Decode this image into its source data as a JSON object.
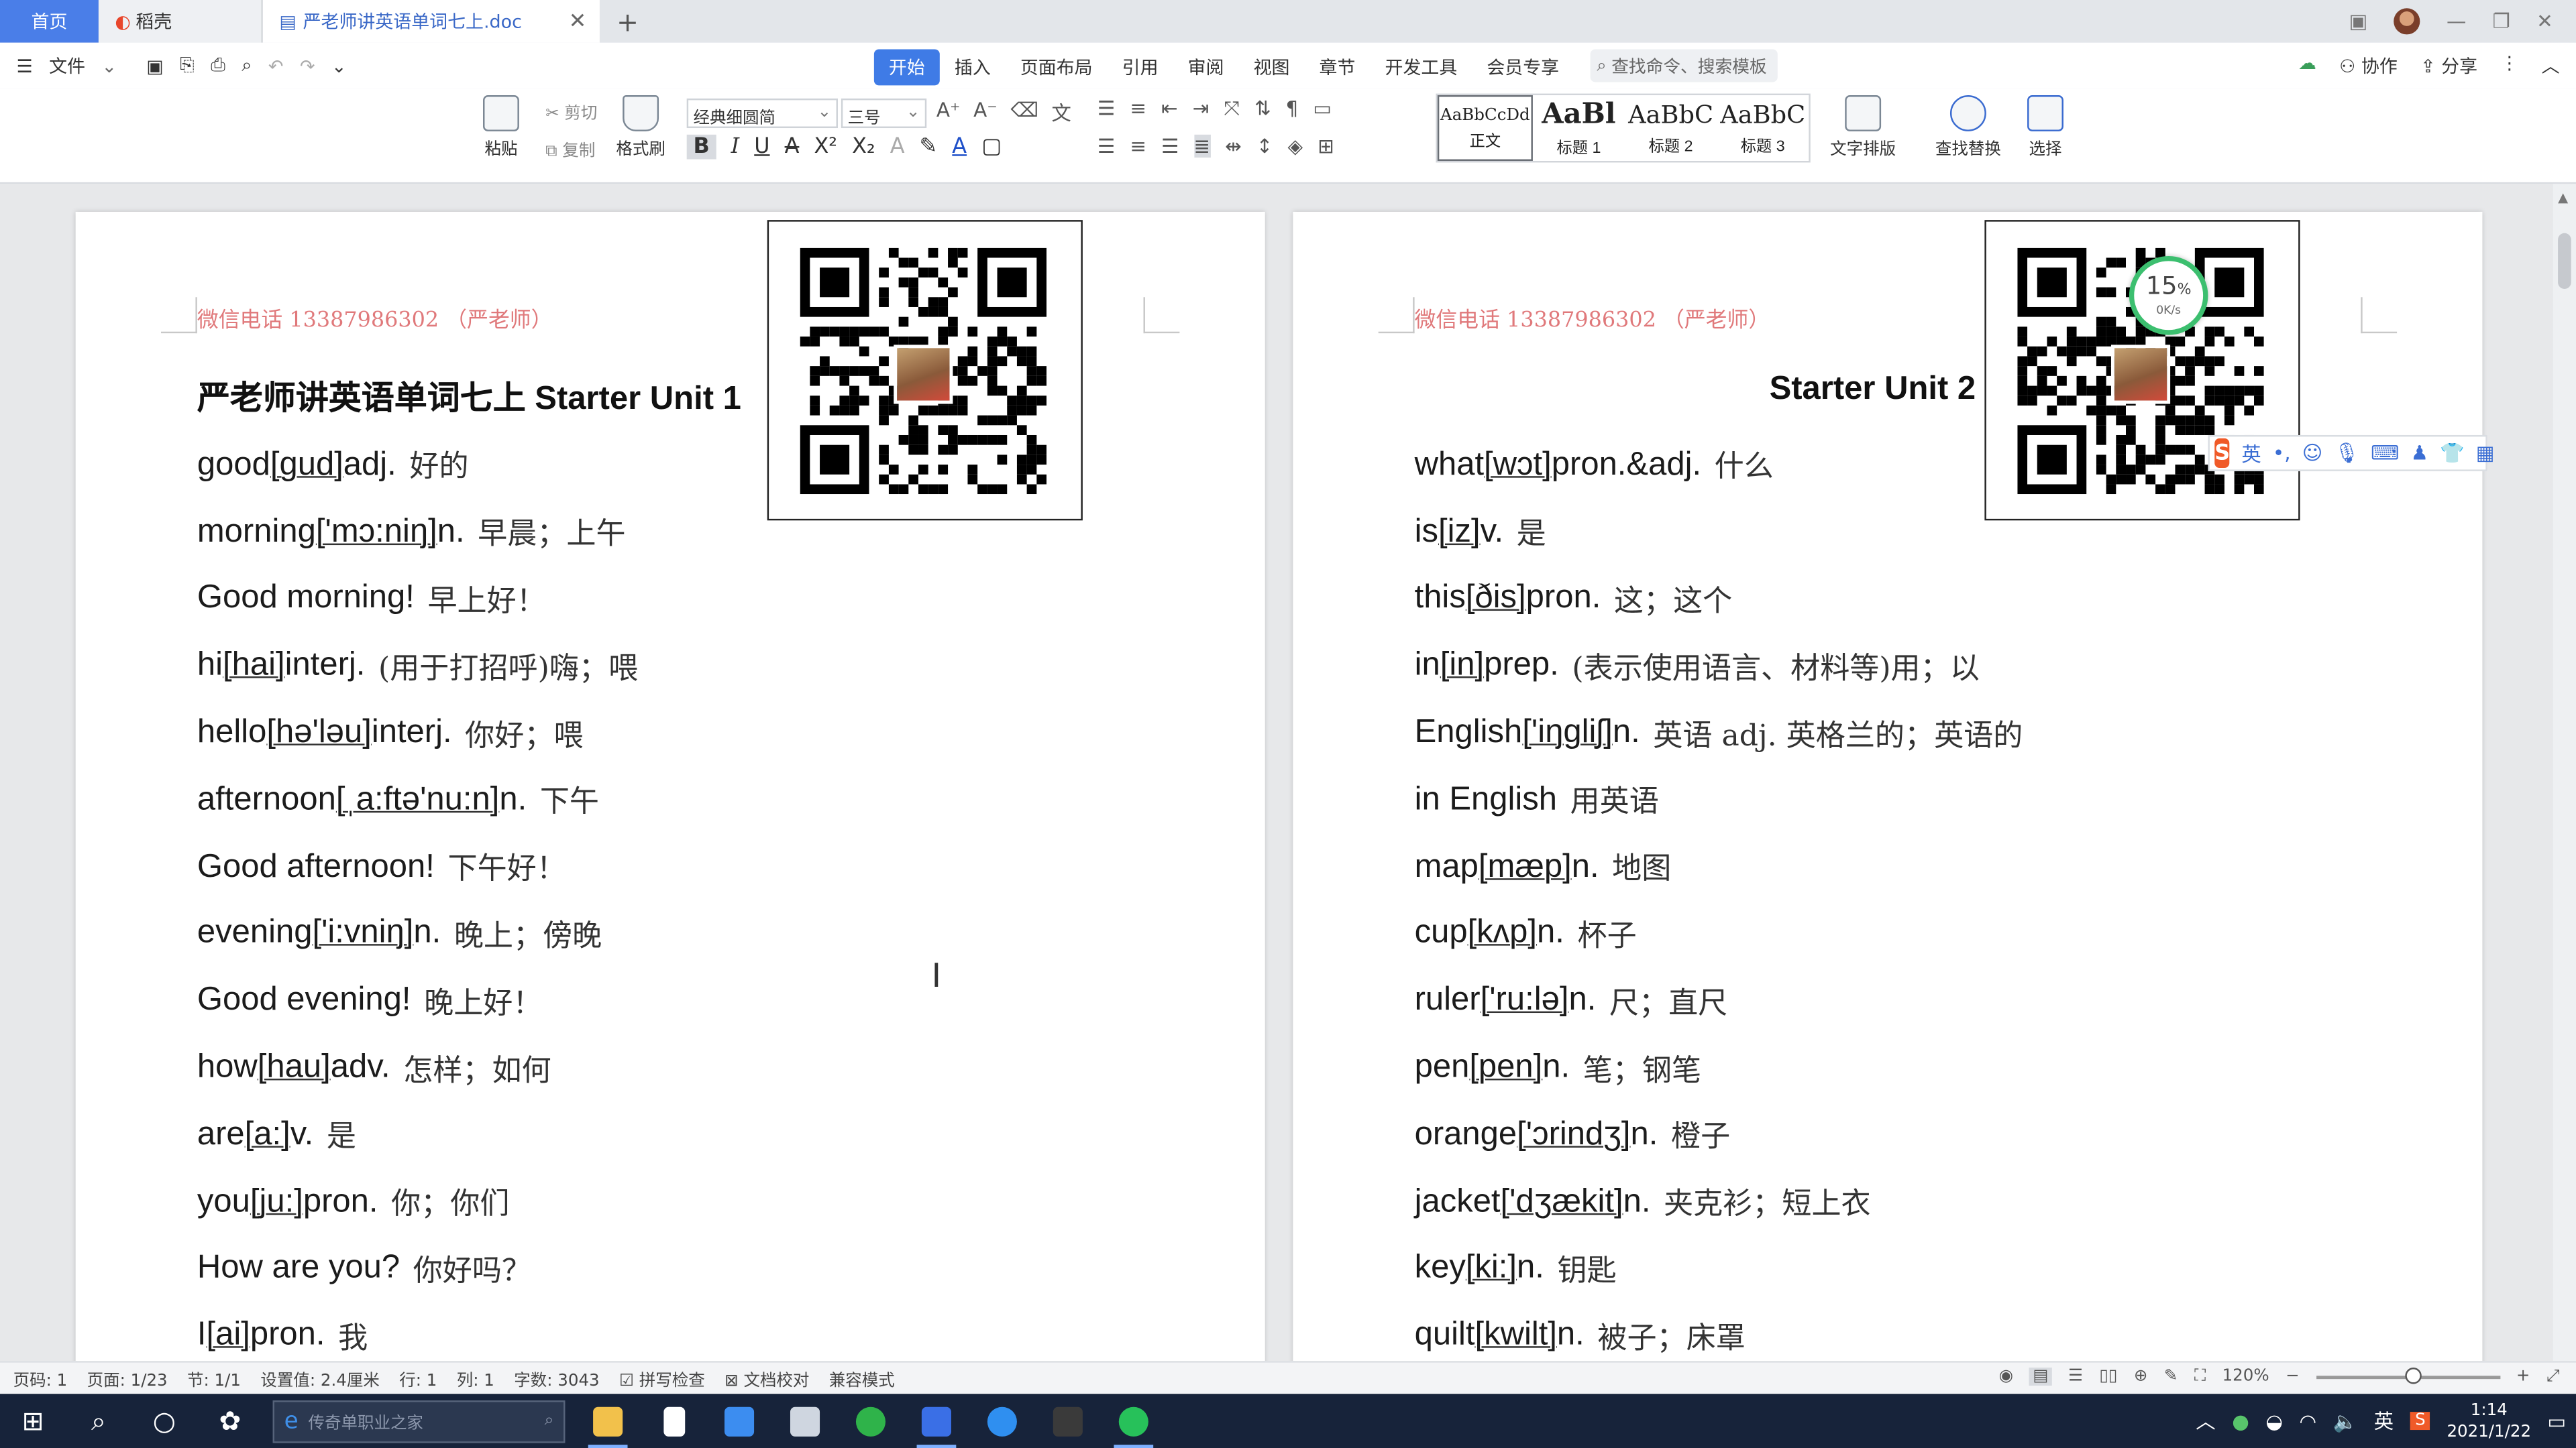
{
  "tabs": {
    "home": "首页",
    "daoke": "稻壳",
    "document": "严老师讲英语单词七上.doc",
    "new_tab": "+"
  },
  "menu": {
    "file": "文件",
    "ribbon_tabs": [
      "开始",
      "插入",
      "页面布局",
      "引用",
      "审阅",
      "视图",
      "章节",
      "开发工具",
      "会员专享"
    ],
    "search_placeholder": "查找命令、搜索模板",
    "collab": "协作",
    "share": "分享"
  },
  "toolbar": {
    "paste": "粘贴",
    "cut": "剪切",
    "copy": "复制",
    "format_painter": "格式刷",
    "font": "经典细圆简",
    "font_size": "三号",
    "styles": [
      {
        "sample": "AaBbCcDd",
        "label": "正文"
      },
      {
        "sample": "AaBl",
        "label": "标题 1"
      },
      {
        "sample": "AaBbC",
        "label": "标题 2"
      },
      {
        "sample": "AaBbC",
        "label": "标题 3"
      }
    ],
    "text_layout": "文字排版",
    "find_replace": "查找替换",
    "select": "选择"
  },
  "page1": {
    "header": "微信电话 13387986302 （严老师）",
    "title": "严老师讲英语单词七上 Starter Unit 1",
    "entries": [
      {
        "word": "good ",
        "phon": "[gud]",
        "pos": " adj.",
        "cn": "好的"
      },
      {
        "word": "morning ",
        "phon": "['mɔ:niŋ]",
        "pos": " n.",
        "cn": "早晨；上午"
      },
      {
        "word": "Good morning!",
        "phon": "",
        "pos": "",
        "cn": "早上好！"
      },
      {
        "word": "hi ",
        "phon": "[hai]",
        "pos": " interj.",
        "cn": "(用于打招呼)嗨；喂"
      },
      {
        "word": "hello ",
        "phon": "[hə'ləu]",
        "pos": " interj.",
        "cn": "你好；喂"
      },
      {
        "word": "afternoon ",
        "phon": "[ˌa:ftə'nu:n]",
        "pos": " n.",
        "cn": "下午"
      },
      {
        "word": "Good afternoon!",
        "phon": "",
        "pos": "",
        "cn": "下午好！"
      },
      {
        "word": "evening ",
        "phon": "['i:vniŋ]",
        "pos": " n.",
        "cn": "晚上；傍晚"
      },
      {
        "word": "Good evening!",
        "phon": "",
        "pos": "",
        "cn": "晚上好！"
      },
      {
        "word": "how ",
        "phon": "[hau]",
        "pos": " adv.",
        "cn": "怎样；如何"
      },
      {
        "word": "are ",
        "phon": "[a:]",
        "pos": " v.",
        "cn": "是"
      },
      {
        "word": "you ",
        "phon": "[ju:]",
        "pos": " pron.",
        "cn": "你；你们"
      },
      {
        "word": "How are you?",
        "phon": "",
        "pos": "",
        "cn": "你好吗？"
      },
      {
        "word": "I ",
        "phon": "[ai]",
        "pos": " pron.",
        "cn": "我"
      }
    ]
  },
  "page2": {
    "header": "微信电话 13387986302 （严老师）",
    "title": "Starter Unit 2",
    "entries": [
      {
        "word": "what ",
        "phon": "[wɔt]",
        "pos": " pron.&adj.",
        "cn": "什么"
      },
      {
        "word": "is ",
        "phon": "[iz]",
        "pos": " v.",
        "cn": "是"
      },
      {
        "word": "this ",
        "phon": "[ðis]",
        "pos": " pron.",
        "cn": "这；这个"
      },
      {
        "word": "in ",
        "phon": "[in]",
        "pos": " prep.",
        "cn": "(表示使用语言、材料等)用；以"
      },
      {
        "word": "English ",
        "phon": "['iŋgliʃ]",
        "pos": " n.",
        "cn": "英语 adj. 英格兰的；英语的"
      },
      {
        "word": "in English",
        "phon": "",
        "pos": "",
        "cn": "用英语"
      },
      {
        "word": "map ",
        "phon": "[mæp]",
        "pos": " n.",
        "cn": "地图"
      },
      {
        "word": "cup ",
        "phon": "[kʌp]",
        "pos": " n.",
        "cn": "杯子"
      },
      {
        "word": "ruler ",
        "phon": "['ru:lə]",
        "pos": " n.",
        "cn": "尺；直尺"
      },
      {
        "word": "pen ",
        "phon": "[pen]",
        "pos": " n.",
        "cn": "笔；钢笔"
      },
      {
        "word": "orange ",
        "phon": "['ɔrindʒ]",
        "pos": " n.",
        "cn": "橙子"
      },
      {
        "word": "jacket ",
        "phon": "['dʒækit]",
        "pos": " n.",
        "cn": "夹克衫；短上衣"
      },
      {
        "word": "key ",
        "phon": "[ki:]",
        "pos": " n.",
        "cn": "钥匙"
      },
      {
        "word": "quilt ",
        "phon": "[kwilt]",
        "pos": " n.",
        "cn": "被子；床罩"
      }
    ]
  },
  "net_monitor": {
    "percent": "15",
    "unit": "%",
    "rate": "0K/s"
  },
  "ime": {
    "lang": "英"
  },
  "status": {
    "page_no": "页码: 1",
    "pages": "页面: 1/23",
    "section": "节: 1/1",
    "setting": "设置值: 2.4厘米",
    "row": "行: 1",
    "col": "列: 1",
    "word_count": "字数: 3043",
    "spell_check": "拼写检查",
    "doc_check": "文档校对",
    "compat": "兼容模式",
    "zoom": "120%"
  },
  "taskbar": {
    "search_placeholder": "传奇单职业之家",
    "ime_lang": "英",
    "time": "1:14",
    "date": "2021/1/22"
  }
}
